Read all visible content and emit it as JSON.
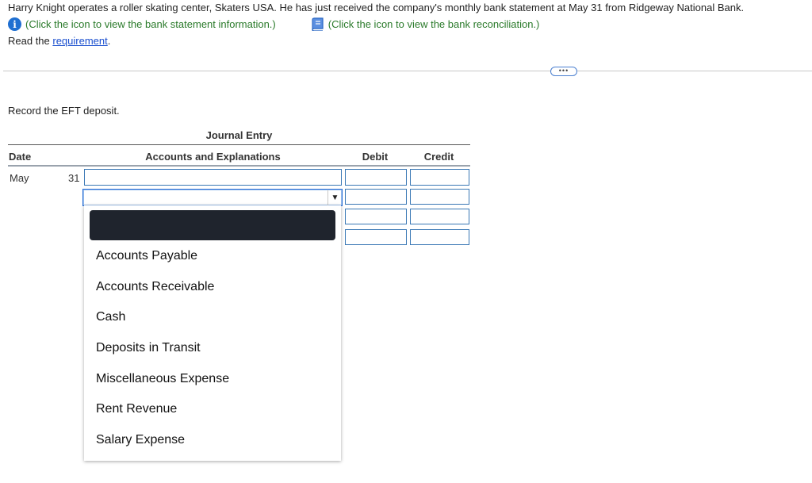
{
  "header": {
    "intro": "Harry Knight operates a roller skating center, Skaters USA. He has just received the company's monthly bank statement at May 31 from Ridgeway National Bank.",
    "info_link": "(Click the icon to view the bank statement information.)",
    "recon_link": "(Click the icon to view the bank reconciliation.)",
    "read_prefix": "Read the ",
    "requirement_link": "requirement",
    "read_suffix": ".",
    "more_button": "•••"
  },
  "task": {
    "instruction": "Record the EFT deposit."
  },
  "journal": {
    "title": "Journal Entry",
    "columns": {
      "date": "Date",
      "accounts": "Accounts and Explanations",
      "debit": "Debit",
      "credit": "Credit"
    },
    "rows": [
      {
        "month": "May",
        "day": "31"
      }
    ]
  },
  "dropdown": {
    "arrow": "▼",
    "selected": "",
    "options": [
      "Accounts Payable",
      "Accounts Receivable",
      "Cash",
      "Deposits in Transit",
      "Miscellaneous Expense",
      "Rent Revenue",
      "Salary Expense"
    ]
  },
  "colors": {
    "link_green": "#2a7a2a",
    "link_blue": "#1a4fcf",
    "input_border": "#3a78b5",
    "selected_bg": "#1f242d"
  }
}
